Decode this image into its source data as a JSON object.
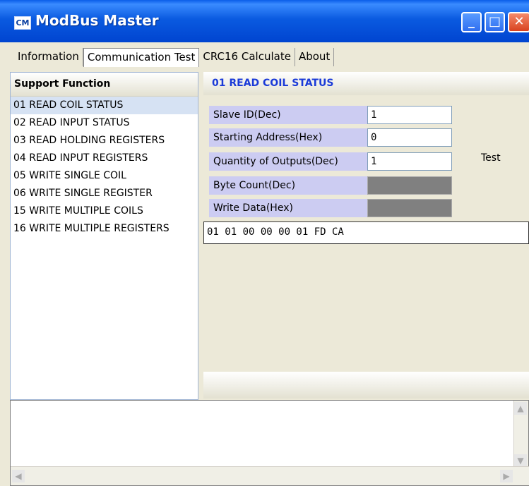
{
  "window": {
    "app_icon": "CM",
    "title": "ModBus Master"
  },
  "tabs": [
    "Information",
    "Communication Test",
    "CRC16 Calculate",
    "About"
  ],
  "left": {
    "header": "Support Function",
    "items": [
      "01 READ COIL STATUS",
      "02 READ INPUT STATUS",
      "03 READ HOLDING REGISTERS",
      "04 READ INPUT REGISTERS",
      "05 WRITE SINGLE COIL",
      "06 WRITE SINGLE REGISTER",
      "15 WRITE MULTIPLE COILS",
      "16 WRITE MULTIPLE REGISTERS"
    ]
  },
  "right": {
    "header": "01 READ COIL STATUS",
    "fields": [
      {
        "label": "Slave ID(Dec)",
        "value": "1"
      },
      {
        "label": "Starting Address(Hex)",
        "value": "0"
      },
      {
        "label": "Quantity of Outputs(Dec)",
        "value": "1"
      },
      {
        "label": "Byte Count(Dec)",
        "value": ""
      },
      {
        "label": "Write Data(Hex)",
        "value": ""
      }
    ],
    "test_label": "Test",
    "output": "01 01 00 00 00 01 FD CA"
  }
}
